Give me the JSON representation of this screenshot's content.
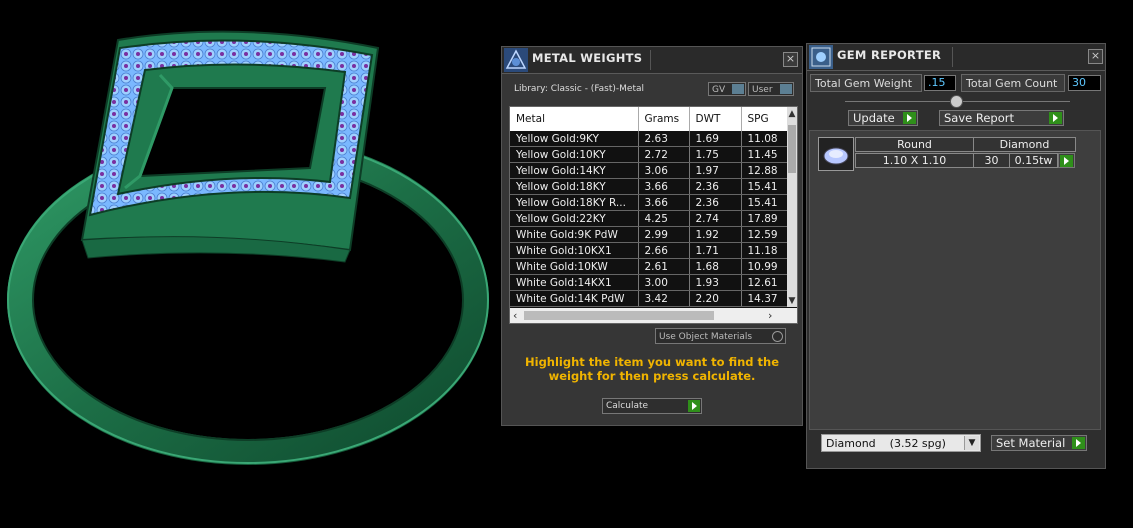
{
  "metal_weights": {
    "title": "METAL WEIGHTS",
    "library": "Library: Classic - (Fast)-Metal",
    "gv_label": "GV",
    "user_label": "User",
    "columns": [
      "Metal",
      "Grams",
      "DWT",
      "SPG"
    ],
    "rows": [
      [
        "Yellow Gold:9KY",
        "2.63",
        "1.69",
        "11.08"
      ],
      [
        "Yellow Gold:10KY",
        "2.72",
        "1.75",
        "11.45"
      ],
      [
        "Yellow Gold:14KY",
        "3.06",
        "1.97",
        "12.88"
      ],
      [
        "Yellow Gold:18KY",
        "3.66",
        "2.36",
        "15.41"
      ],
      [
        "Yellow Gold:18KY R...",
        "3.66",
        "2.36",
        "15.41"
      ],
      [
        "Yellow Gold:22KY",
        "4.25",
        "2.74",
        "17.89"
      ],
      [
        "White Gold:9K PdW",
        "2.99",
        "1.92",
        "12.59"
      ],
      [
        "White Gold:10KX1",
        "2.66",
        "1.71",
        "11.18"
      ],
      [
        "White Gold:10KW",
        "2.61",
        "1.68",
        "10.99"
      ],
      [
        "White Gold:14KX1",
        "3.00",
        "1.93",
        "12.61"
      ],
      [
        "White Gold:14K PdW",
        "3.42",
        "2.20",
        "14.37"
      ]
    ],
    "use_object_materials": "Use Object Materials",
    "hint": "Highlight the item you want to find the weight for then press calculate.",
    "calculate": "Calculate"
  },
  "gem_reporter": {
    "title": "GEM REPORTER",
    "total_weight_label": "Total Gem Weight",
    "total_weight_value": ".15",
    "total_count_label": "Total Gem Count",
    "total_count_value": "30",
    "update": "Update",
    "save_report": "Save Report",
    "gem": {
      "shape": "Round",
      "material": "Diamond",
      "size": "1.10 X 1.10",
      "count": "30",
      "weight": "0.15tw"
    },
    "material_select": "Diamond    (3.52 spg)",
    "set_material": "Set Material"
  },
  "colors": {
    "ring_green": "#1f7a4e",
    "gem_blue": "#7ab8ff",
    "gem_purple": "#7a2fa0",
    "hint_yellow": "#f0b400",
    "value_blue": "#5ec8ff",
    "play_green": "#2f8f1a"
  },
  "icons": [
    "metal-weights-app-icon",
    "gem-reporter-app-icon",
    "close-icon",
    "play-icon",
    "dropdown-arrow-icon",
    "gem-round-icon"
  ]
}
